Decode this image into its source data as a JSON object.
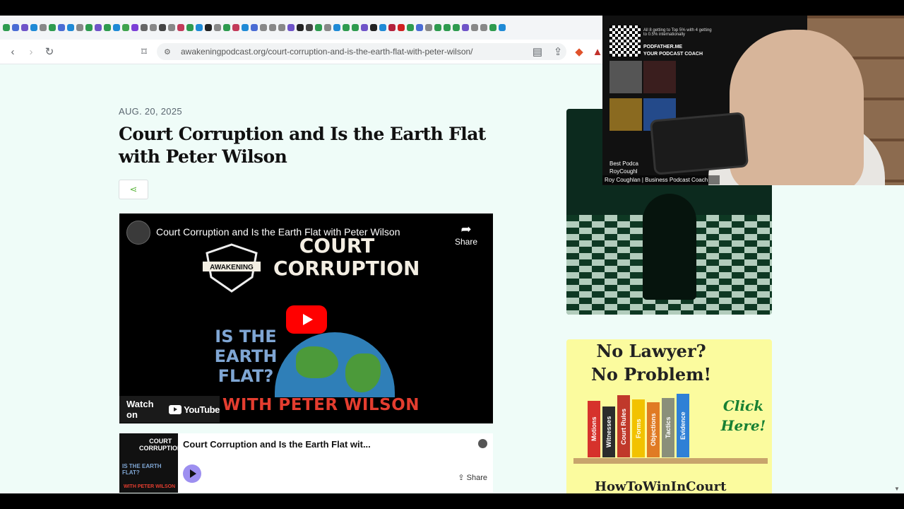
{
  "browser": {
    "url": "awakeningpodcast.org/court-corruption-and-is-the-earth-flat-with-peter-wilson/",
    "bookmark_colors": [
      "#2e9b4f",
      "#4a6cd4",
      "#6f54c8",
      "#1f8ad6",
      "#888",
      "#2e9b4f",
      "#4a6cd4",
      "#1f8ad6",
      "#888",
      "#2e9b4f",
      "#6f54c8",
      "#2e9b4f",
      "#1f8ad6",
      "#3fa34d",
      "#7b3fd6",
      "#666",
      "#888",
      "#444",
      "#888",
      "#c23b5a",
      "#2e9b4f",
      "#1f8ad6",
      "#222",
      "#888",
      "#2e9b4f",
      "#c23b5a",
      "#1f8ad6",
      "#4a6cd4",
      "#888",
      "#888",
      "#888",
      "#6f54c8",
      "#222",
      "#444",
      "#2e9b4f",
      "#888",
      "#1f8ad6",
      "#2e9b4f",
      "#2e9b4f",
      "#6f54c8",
      "#222",
      "#1f8ad6",
      "#b3213c",
      "#d02020",
      "#2e9b4f",
      "#4a6cd4",
      "#888",
      "#2e9b4f",
      "#2e9b4f",
      "#2e9b4f",
      "#6f54c8",
      "#888",
      "#888",
      "#2e9b4f",
      "#1f8ad6"
    ]
  },
  "article": {
    "date": "AUG. 20, 2025",
    "title": "Court Corruption and Is the Earth Flat with Peter Wilson"
  },
  "video": {
    "title": "Court Corruption and Is the Earth Flat with Peter Wilson",
    "share_label": "Share",
    "brand": "AWAKENING",
    "art_line1": "COURT",
    "art_line2": "CORRUPTION",
    "art_q": "IS THE EARTH FLAT?",
    "art_with": "WITH PETER WILSON",
    "watch_on": "Watch on",
    "youtube": "YouTube"
  },
  "spotify": {
    "title": "Court Corruption and Is the Earth Flat wit...",
    "share_label": "Share",
    "thumb_line1": "COURT CORRUPTION",
    "thumb_line2": "IS THE EARTH FLAT?",
    "thumb_line3": "WITH PETER WILSON"
  },
  "ad2": {
    "headline1": "No Lawyer?",
    "headline2": "No Problem!",
    "click": "Click Here!",
    "site": "HowToWinInCourt",
    "books": [
      {
        "label": "Motions",
        "color": "#d6322c"
      },
      {
        "label": "Witnesses",
        "color": "#2c2c2c"
      },
      {
        "label": "Court Rules",
        "color": "#c0392b"
      },
      {
        "label": "Forms",
        "color": "#f2c200"
      },
      {
        "label": "Objections",
        "color": "#e07b24"
      },
      {
        "label": "Tactics",
        "color": "#8a8f7a"
      },
      {
        "label": "Evidence",
        "color": "#2f80d6"
      }
    ]
  },
  "webcam": {
    "promo_text": "All 8 getting to Top 5% with 4 getting to 0.5% internationally",
    "brand1": "PODFATHER.ME",
    "brand2": "YOUR PODCAST COACH",
    "best": "Best Podca",
    "name_frag": "RoyCoughl",
    "caption": "Roy Coughlan | Business Podcast Coach"
  }
}
